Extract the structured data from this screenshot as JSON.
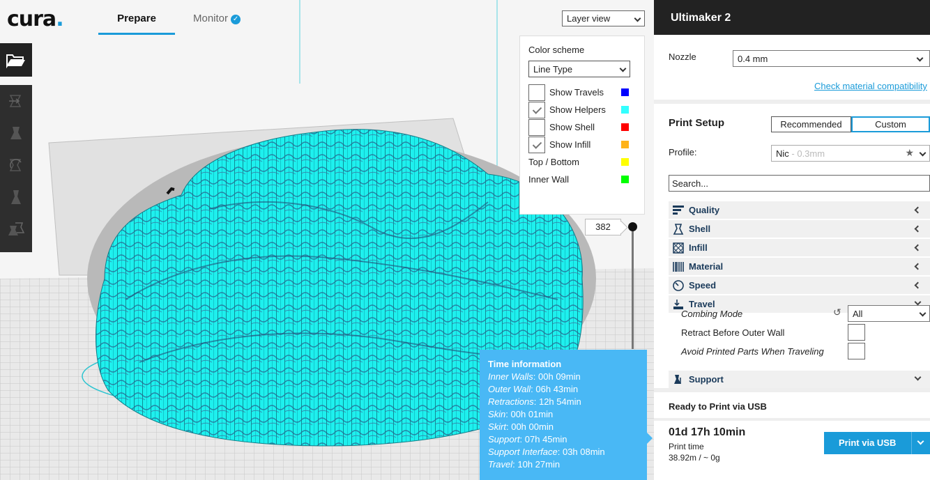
{
  "app": {
    "logo": "cura",
    "logo_dot": "."
  },
  "tabs": {
    "prepare": "Prepare",
    "monitor": "Monitor"
  },
  "viewport": {
    "view_mode": "Layer view",
    "color_scheme": {
      "title": "Color scheme",
      "selected": "Line Type",
      "items": [
        {
          "label": "Show Travels",
          "checkbox": true,
          "checked": false,
          "color": "#0000ff"
        },
        {
          "label": "Show Helpers",
          "checkbox": true,
          "checked": true,
          "color": "#33ffff"
        },
        {
          "label": "Show Shell",
          "checkbox": true,
          "checked": false,
          "color": "#ff0000"
        },
        {
          "label": "Show Infill",
          "checkbox": true,
          "checked": true,
          "color": "#ffb319"
        },
        {
          "label": "Top / Bottom",
          "checkbox": false,
          "color": "#ffff00"
        },
        {
          "label": "Inner Wall",
          "checkbox": false,
          "color": "#00ff00"
        }
      ]
    },
    "layer_number": "382",
    "time_info": {
      "title": "Time information",
      "rows": [
        {
          "label": "Inner Walls",
          "value": ": 00h 09min"
        },
        {
          "label": "Outer Wall",
          "value": ": 06h 43min"
        },
        {
          "label": "Retractions",
          "value": ": 12h 54min"
        },
        {
          "label": "Skin",
          "value": ": 00h 01min"
        },
        {
          "label": "Skirt",
          "value": ": 00h 00min"
        },
        {
          "label": "Support",
          "value": ": 07h 45min"
        },
        {
          "label": "Support Interface",
          "value": ": 03h 08min"
        },
        {
          "label": "Travel",
          "value": ": 10h 27min"
        }
      ]
    }
  },
  "sidebar": {
    "machine": "Ultimaker 2",
    "nozzle_label": "Nozzle",
    "nozzle_value": "0.4 mm",
    "check_material": "Check material compatibility",
    "print_setup": "Print Setup",
    "mode_recommended": "Recommended",
    "mode_custom": "Custom",
    "profile_label": "Profile:",
    "profile_value": "Nic",
    "profile_layer": " - 0.3mm",
    "search_placeholder": "Search...",
    "categories": {
      "quality": "Quality",
      "shell": "Shell",
      "infill": "Infill",
      "material": "Material",
      "speed": "Speed",
      "travel": "Travel",
      "support": "Support"
    },
    "travel_settings": {
      "combing_label": "Combing Mode",
      "combing_value": "All",
      "retract_label": "Retract Before Outer Wall",
      "avoid_label": "Avoid Printed Parts When Traveling"
    },
    "print": {
      "title": "Ready to Print via USB",
      "time": "01d 17h 10min",
      "time_label": "Print time",
      "material": "38.92m / ~ 0g",
      "button": "Print via USB"
    }
  }
}
